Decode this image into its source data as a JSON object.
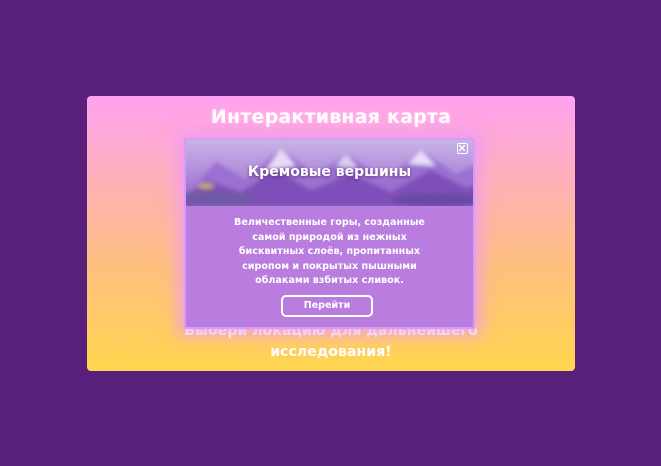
{
  "page": {
    "background_color": "#58207a"
  },
  "map_card": {
    "title": "Интерактивная карта",
    "subtitle_line1": "Выбери локацию для дальнейшего",
    "subtitle_line2": "исследования!",
    "gradient_top": "#ffa2f2",
    "gradient_bottom": "#ffd54f"
  },
  "location_modal": {
    "title": "Кремовые вершины",
    "description_lines": [
      "Величественные горы, созданные",
      "самой природой из нежных",
      "бисквитных слоёв, пропитанных",
      "сиропом и покрытых пышными",
      "облаками взбитых сливок."
    ],
    "go_button_label": "Перейти",
    "close_icon": "close-icon",
    "hero_image": "mountains-image",
    "background_color": "#b97ddf",
    "glow_color": "#ec96ff"
  }
}
